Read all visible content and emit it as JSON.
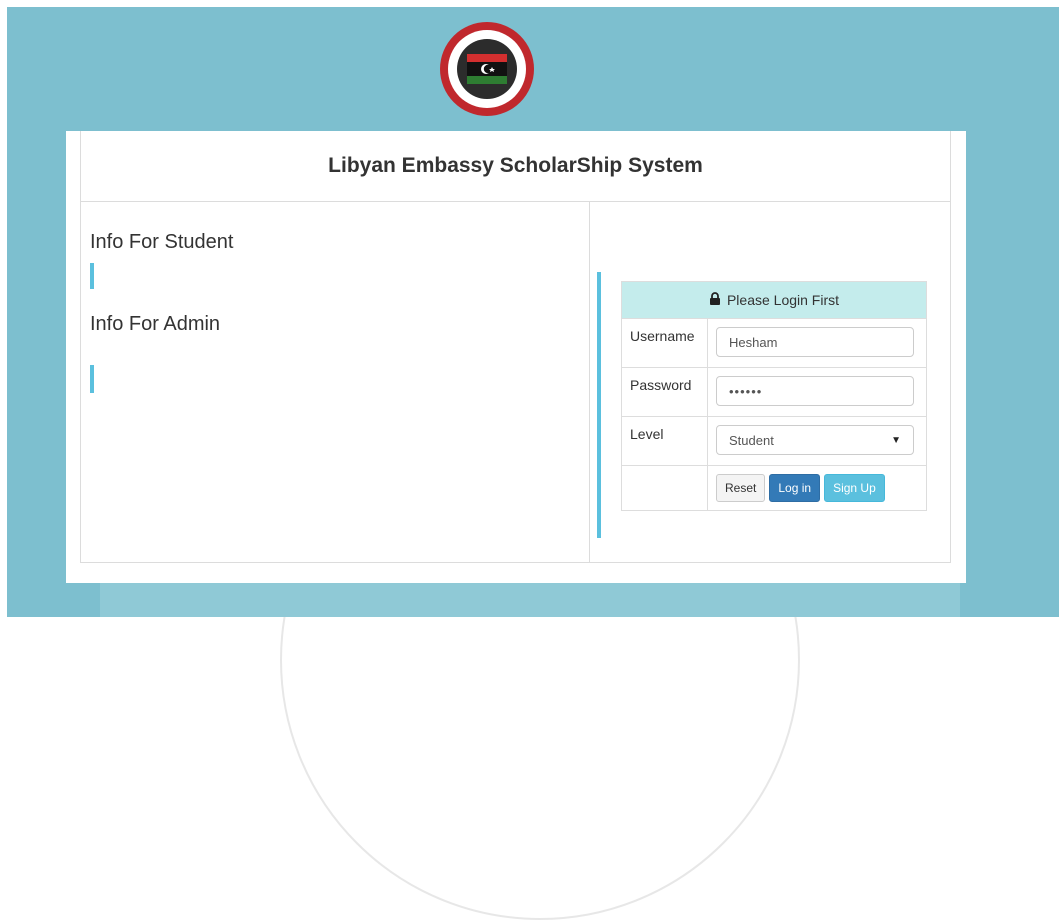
{
  "header": {
    "logo_icon": "libyan-embassy-seal-icon"
  },
  "panel": {
    "title": "Libyan Embassy ScholarShip System"
  },
  "info": {
    "student_heading": "Info For Student",
    "admin_heading": "Info For Admin"
  },
  "login": {
    "header_icon": "lock-icon",
    "header_text": "Please Login First",
    "username_label": "Username",
    "username_value": "Hesham",
    "password_label": "Password",
    "password_value": "••••••",
    "level_label": "Level",
    "level_value": "Student",
    "reset_label": "Reset",
    "login_label": "Log in",
    "signup_label": "Sign Up"
  },
  "colors": {
    "background": "#7dbfcf",
    "accent": "#5bc0de",
    "primary_button": "#337ab7",
    "login_header": "#c4ecec"
  }
}
